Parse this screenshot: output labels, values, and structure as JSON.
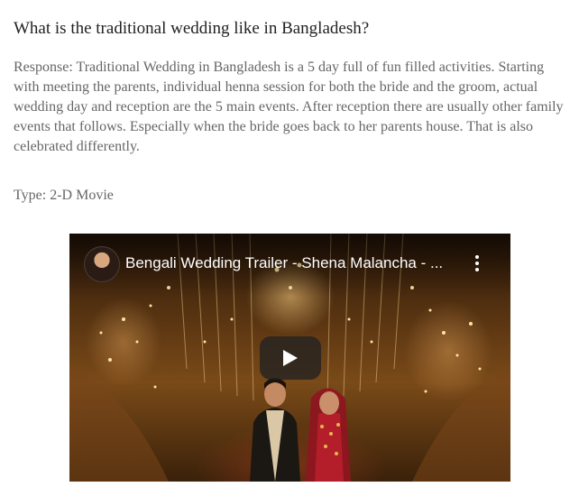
{
  "question": "What is the traditional wedding like in Bangladesh?",
  "response": "Response: Traditional Wedding in Bangladesh is a 5 day full of fun filled activities. Starting with meeting the parents, individual henna session for both the bride and the groom, actual wedding day and reception are the 5 main events. After reception there are usually other family events that follows. Especially when the bride goes back to her parents house. That is also celebrated differently.",
  "type": "Type: 2-D Movie",
  "video": {
    "title": "Bengali Wedding Trailer - Shena Malancha - ...",
    "icons": {
      "channel": "channel-avatar",
      "menu": "more-vert-icon",
      "play": "play-icon"
    },
    "colors": {
      "play_button_bg": "#212121",
      "title_text": "#ffffff"
    }
  }
}
